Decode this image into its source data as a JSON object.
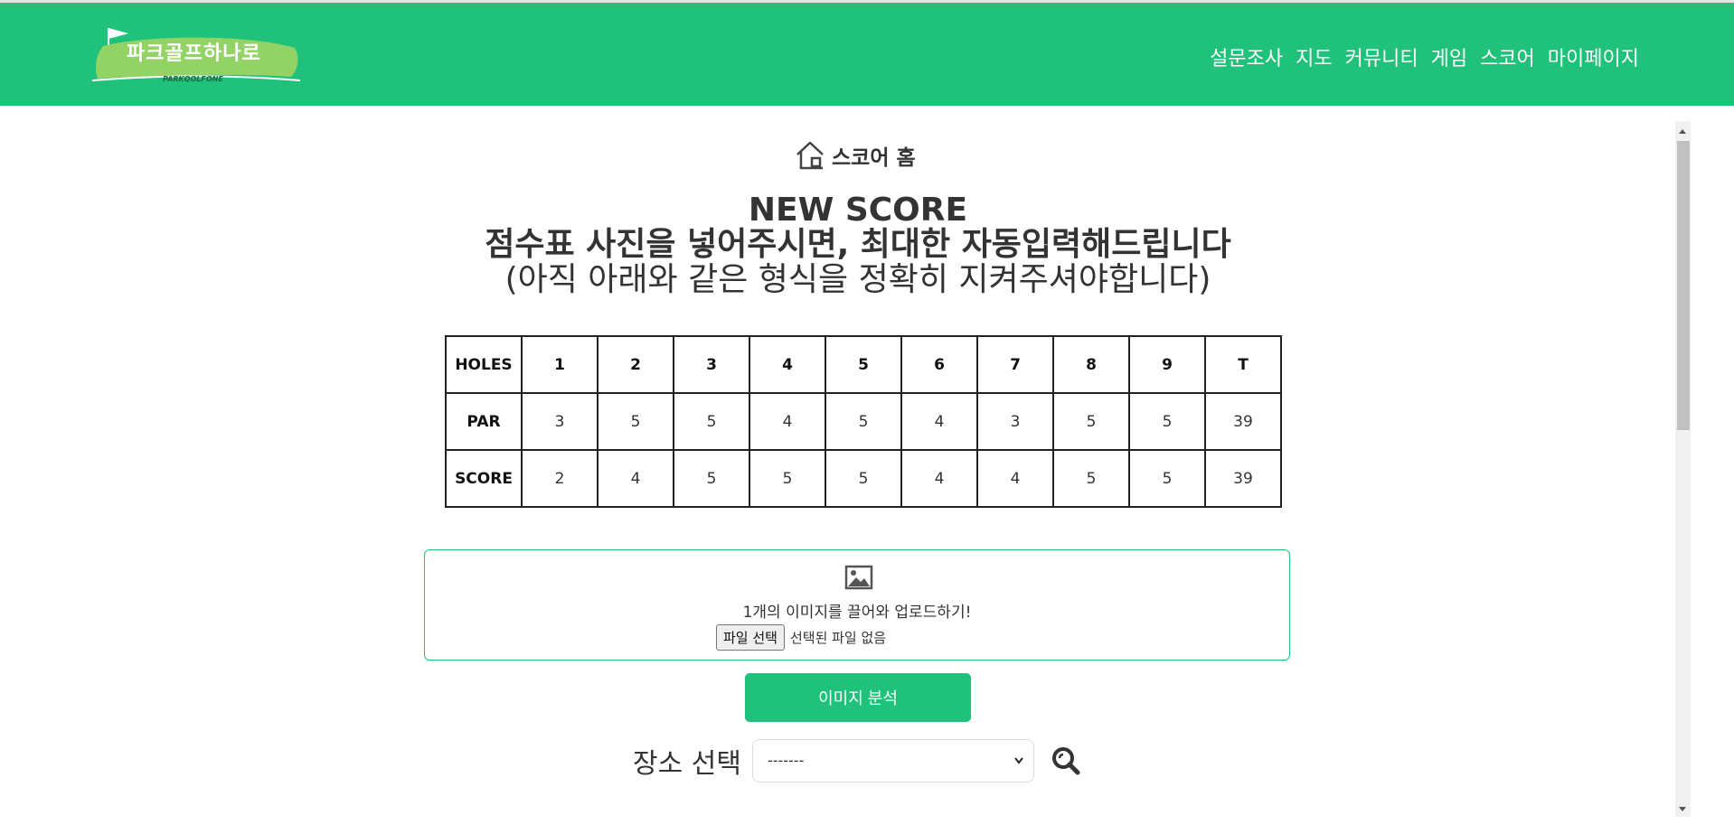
{
  "header": {
    "logo_text": "파크골프하나로",
    "logo_subtext": "PARKQOLFONE",
    "nav": [
      "설문조사",
      "지도",
      "커뮤니티",
      "게임",
      "스코어",
      "마이페이지"
    ],
    "bg_color": "#20c17a"
  },
  "score_home": {
    "label": "스코어 홈",
    "icon": "home-icon"
  },
  "titles": {
    "title": "NEW SCORE",
    "subtitle": "점수표 사진을 넣어주시면, 최대한 자동입력해드립니다",
    "note": "(아직 아래와 같은 형식을 정확히 지켜주셔야합니다)"
  },
  "score_table": {
    "header": [
      "HOLES",
      "1",
      "2",
      "3",
      "4",
      "5",
      "6",
      "7",
      "8",
      "9",
      "T"
    ],
    "rows": [
      [
        "PAR",
        "3",
        "5",
        "5",
        "4",
        "5",
        "4",
        "3",
        "5",
        "5",
        "39"
      ],
      [
        "SCORE",
        "2",
        "4",
        "5",
        "5",
        "5",
        "4",
        "4",
        "5",
        "5",
        "39"
      ]
    ]
  },
  "upload": {
    "icon": "image-icon",
    "instruction": "1개의 이미지를 끌어와 업로드하기!",
    "file_button": "파일 선택",
    "file_status": "선택된 파일 없음"
  },
  "analyze_button": "이미지 분석",
  "place": {
    "label": "장소 선택",
    "selected": "-------",
    "search_icon": "search-icon"
  },
  "accent_color": "#20c17a"
}
